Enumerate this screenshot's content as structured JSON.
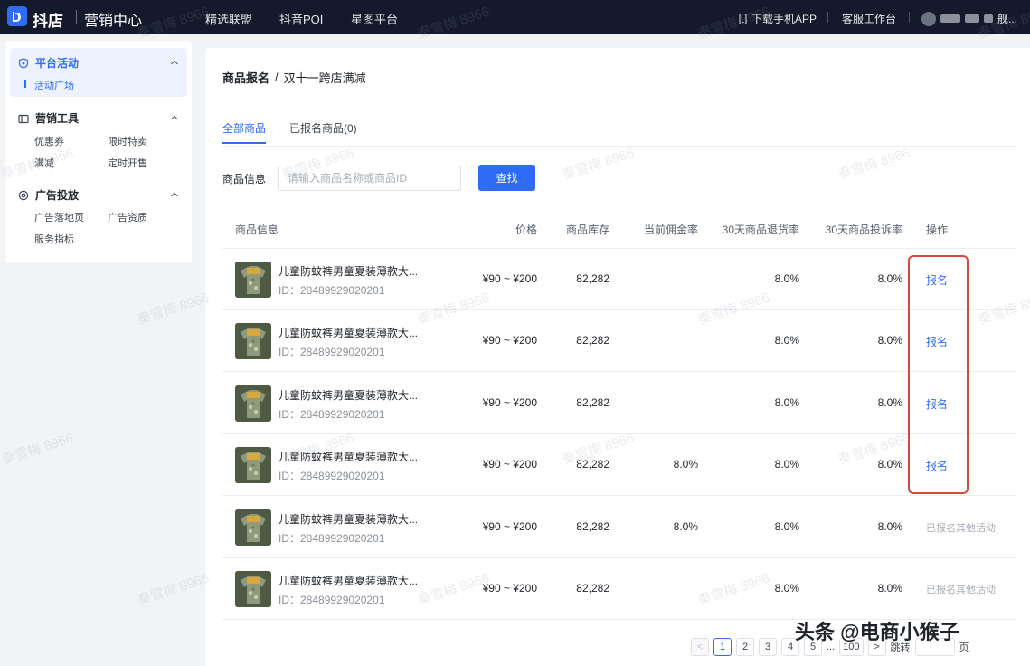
{
  "topbar": {
    "logo_text": "抖店",
    "logo_sub": "营销中心",
    "nav": [
      "精选联盟",
      "抖音POI",
      "星图平台"
    ],
    "download_app": "下载手机APP",
    "service_desk": "客服工作台",
    "user_suffix": "舰..."
  },
  "sidebar": {
    "groups": [
      {
        "title": "平台活动",
        "items": [
          "活动广场"
        ]
      },
      {
        "title": "营销工具",
        "items": [
          "优惠券",
          "限时特卖",
          "满减",
          "定时开售"
        ]
      },
      {
        "title": "广告投放",
        "items": [
          "广告落地页",
          "广告资质",
          "服务指标"
        ]
      }
    ]
  },
  "breadcrumb": {
    "main": "商品报名",
    "sep": "/",
    "sub": "双十一跨店满减"
  },
  "tabs": [
    "全部商品",
    "已报名商品(0)"
  ],
  "filter": {
    "label": "商品信息",
    "placeholder": "请输入商品名称或商品ID",
    "search_button": "查找"
  },
  "table": {
    "headers": [
      "商品信息",
      "价格",
      "商品库存",
      "当前佣金率",
      "30天商品退货率",
      "30天商品投诉率",
      "操作"
    ],
    "rows": [
      {
        "name": "儿童防蚊裤男童夏装薄款大...",
        "id": "ID：28489929020201",
        "price": "¥90 ~ ¥200",
        "stock": "82,282",
        "commission": "",
        "return_rate": "8.0%",
        "complaint_rate": "8.0%",
        "action": "报名",
        "action_enabled": true
      },
      {
        "name": "儿童防蚊裤男童夏装薄款大...",
        "id": "ID：28489929020201",
        "price": "¥90 ~ ¥200",
        "stock": "82,282",
        "commission": "",
        "return_rate": "8.0%",
        "complaint_rate": "8.0%",
        "action": "报名",
        "action_enabled": true
      },
      {
        "name": "儿童防蚊裤男童夏装薄款大...",
        "id": "ID：28489929020201",
        "price": "¥90 ~ ¥200",
        "stock": "82,282",
        "commission": "",
        "return_rate": "8.0%",
        "complaint_rate": "8.0%",
        "action": "报名",
        "action_enabled": true
      },
      {
        "name": "儿童防蚊裤男童夏装薄款大...",
        "id": "ID：28489929020201",
        "price": "¥90 ~ ¥200",
        "stock": "82,282",
        "commission": "8.0%",
        "return_rate": "8.0%",
        "complaint_rate": "8.0%",
        "action": "报名",
        "action_enabled": true
      },
      {
        "name": "儿童防蚊裤男童夏装薄款大...",
        "id": "ID：28489929020201",
        "price": "¥90 ~ ¥200",
        "stock": "82,282",
        "commission": "8.0%",
        "return_rate": "8.0%",
        "complaint_rate": "8.0%",
        "action": "已报名其他活动",
        "action_enabled": false
      },
      {
        "name": "儿童防蚊裤男童夏装薄款大...",
        "id": "ID：28489929020201",
        "price": "¥90 ~ ¥200",
        "stock": "82,282",
        "commission": "",
        "return_rate": "8.0%",
        "complaint_rate": "8.0%",
        "action": "已报名其他活动",
        "action_enabled": false
      }
    ]
  },
  "pagination": {
    "prev": "<",
    "pages": [
      "1",
      "2",
      "3",
      "4",
      "5"
    ],
    "current": "1",
    "ellipsis": "...",
    "last": "100",
    "next": ">",
    "jump_label": "跳转",
    "page_suffix": "页"
  },
  "watermark": "秦雪梅 8966",
  "corner_watermark": "头条 @电商小猴子",
  "colors": {
    "accent": "#2f6cf6",
    "topbar": "#141a2b",
    "highlight": "#d9483b"
  }
}
